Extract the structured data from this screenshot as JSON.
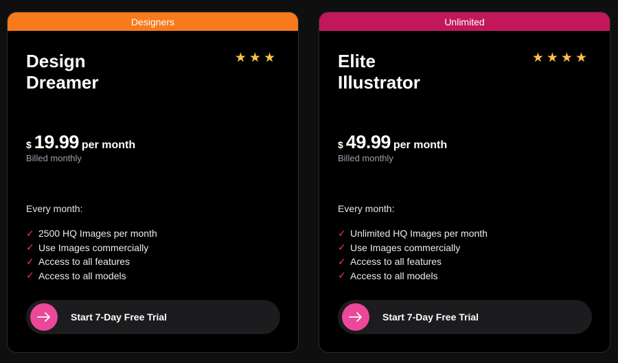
{
  "plans": [
    {
      "banner": "Designers",
      "name_line1": "Design",
      "name_line2": "Dreamer",
      "stars": 3,
      "currency": "$",
      "price": "19.99",
      "period": "per month",
      "billing": "Billed monthly",
      "every_label": "Every month:",
      "features": [
        "2500 HQ Images per month",
        "Use Images commercially",
        "Access to all features",
        "Access to all models"
      ],
      "cta_label": "Start 7-Day Free Trial"
    },
    {
      "banner": "Unlimited",
      "name_line1": "Elite",
      "name_line2": "Illustrator",
      "stars": 4,
      "currency": "$",
      "price": "49.99",
      "period": "per month",
      "billing": "Billed monthly",
      "every_label": "Every month:",
      "features": [
        "Unlimited HQ Images per month",
        "Use Images commercially",
        "Access to all features",
        "Access to all models"
      ],
      "cta_label": "Start 7-Day Free Trial"
    }
  ],
  "colors": {
    "designers_banner": "#f77a1c",
    "unlimited_banner": "#c2185b",
    "star": "#f7c246",
    "check": "#ff2f6e",
    "cta_circle": "#ec4899"
  },
  "icons": {
    "rating": "star-icon",
    "feature": "check-icon",
    "cta": "arrow-right-icon"
  }
}
